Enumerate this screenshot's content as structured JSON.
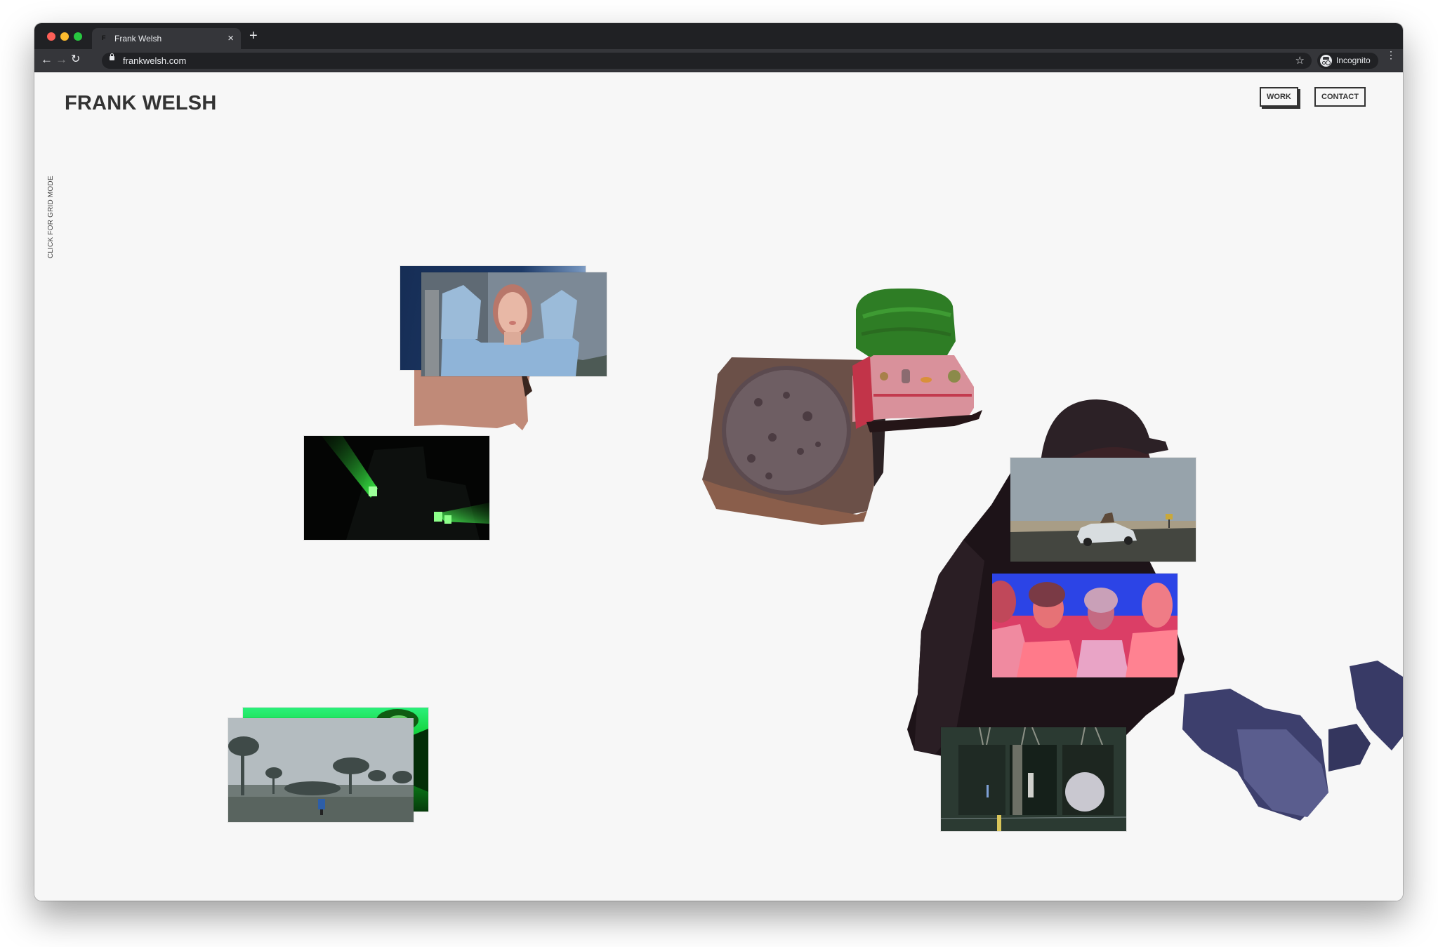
{
  "browser": {
    "tab_title": "Frank Welsh",
    "tab_favicon": "F",
    "tab_close_glyph": "×",
    "new_tab_glyph": "+",
    "back_glyph": "←",
    "forward_glyph": "→",
    "reload_glyph": "↻",
    "url": "frankwelsh.com",
    "star_glyph": "☆",
    "profile_label": "Incognito",
    "menu_glyph": "⋮"
  },
  "header": {
    "logo": "FRANK WELSH",
    "nav": [
      {
        "label": "WORK",
        "active": true
      },
      {
        "label": "CONTACT",
        "active": false
      }
    ]
  },
  "side_toggle": "CLICK FOR GRID MODE",
  "gallery": {
    "tiles": [
      {
        "id": "navy-card",
        "description": "navy blue gradient frame"
      },
      {
        "id": "woman-portrait",
        "description": "red-haired woman in blue tee, hands behind head, overcast sky"
      },
      {
        "id": "pizza-scan",
        "description": "3D scan of pizza in box"
      },
      {
        "id": "green-lasers",
        "description": "green laser beams at night"
      },
      {
        "id": "chocolate-box-scan",
        "description": "3D scan of chocolate cake in box"
      },
      {
        "id": "cake-slice-scan",
        "description": "3D scan of green-topped cake slice"
      },
      {
        "id": "hooded-figure-scan",
        "description": "3D scan of person in cap and hoodie with blue gloves"
      },
      {
        "id": "car-on-road",
        "description": "white sedan on roadside under clear sky"
      },
      {
        "id": "band-portrait",
        "description": "four men lit in pink and blue"
      },
      {
        "id": "forest-triptych",
        "description": "night forest triptych with smoke"
      },
      {
        "id": "green-abstract",
        "description": "green lit face, abstract"
      },
      {
        "id": "eucalyptus-landscape",
        "description": "figure in blue in misty eucalyptus landscape"
      }
    ]
  }
}
